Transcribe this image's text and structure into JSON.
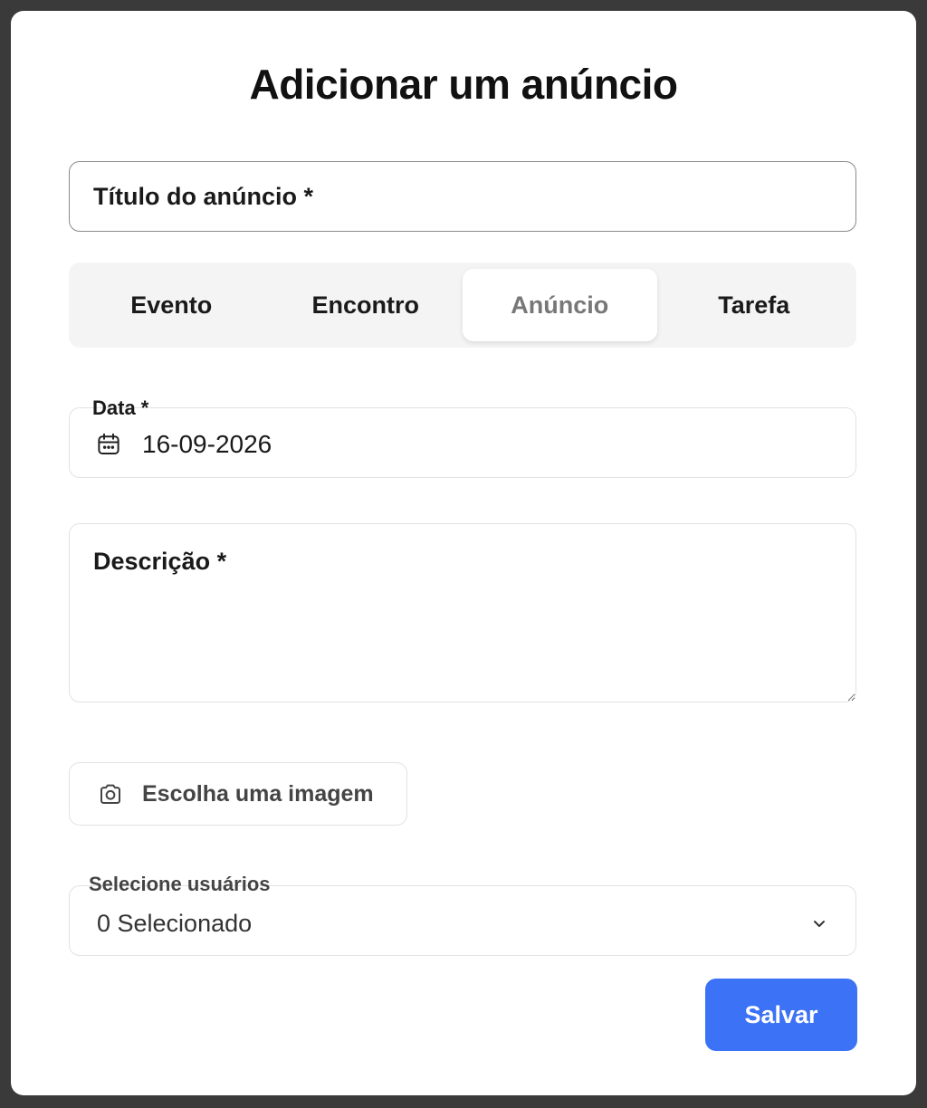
{
  "modal": {
    "title": "Adicionar um anúncio"
  },
  "form": {
    "title_placeholder": "Título do anúncio *",
    "tabs": [
      {
        "label": "Evento"
      },
      {
        "label": "Encontro"
      },
      {
        "label": "Anúncio",
        "active": true
      },
      {
        "label": "Tarefa"
      }
    ],
    "date": {
      "label": "Data *",
      "value": "16-09-2026"
    },
    "description_placeholder": "Descrição *",
    "image_button_label": "Escolha uma imagem",
    "users": {
      "label": "Selecione usuários",
      "value": "0 Selecionado"
    },
    "save_label": "Salvar"
  },
  "icons": {
    "date": "calendar-icon",
    "image": "camera-icon",
    "dropdown": "chevron-down-icon"
  },
  "colors": {
    "primary": "#3b72f6",
    "backdrop": "#3a3a3a"
  }
}
